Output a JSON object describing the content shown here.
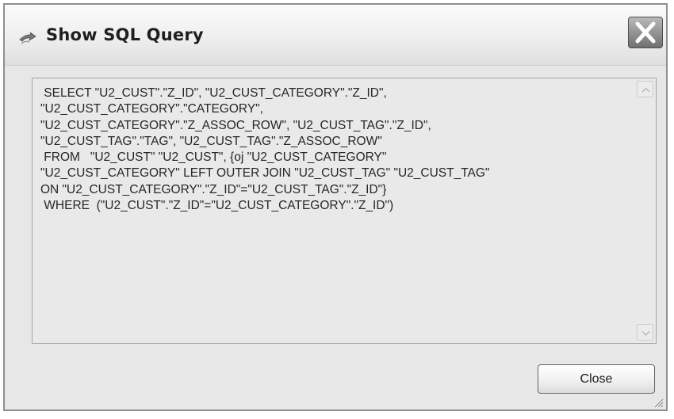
{
  "window": {
    "title": "Show SQL Query",
    "icon": "arrow-app-icon",
    "close_icon": "close-x-icon"
  },
  "query": {
    "lines": [
      " SELECT \"U2_CUST\".\"Z_ID\", \"U2_CUST_CATEGORY\".\"Z_ID\",",
      "\"U2_CUST_CATEGORY\".\"CATEGORY\",",
      "\"U2_CUST_CATEGORY\".\"Z_ASSOC_ROW\", \"U2_CUST_TAG\".\"Z_ID\",",
      "\"U2_CUST_TAG\".\"TAG\", \"U2_CUST_TAG\".\"Z_ASSOC_ROW\"",
      " FROM   \"U2_CUST\" \"U2_CUST\", {oj \"U2_CUST_CATEGORY\"",
      "\"U2_CUST_CATEGORY\" LEFT OUTER JOIN \"U2_CUST_TAG\" \"U2_CUST_TAG\"",
      "ON \"U2_CUST_CATEGORY\".\"Z_ID\"=\"U2_CUST_TAG\".\"Z_ID\"}",
      " WHERE  (\"U2_CUST\".\"Z_ID\"=\"U2_CUST_CATEGORY\".\"Z_ID\")"
    ]
  },
  "buttons": {
    "close_label": "Close"
  },
  "icons": {
    "scroll_up": "chevron-up-icon",
    "scroll_down": "chevron-down-icon",
    "resize": "resize-grip-icon"
  }
}
